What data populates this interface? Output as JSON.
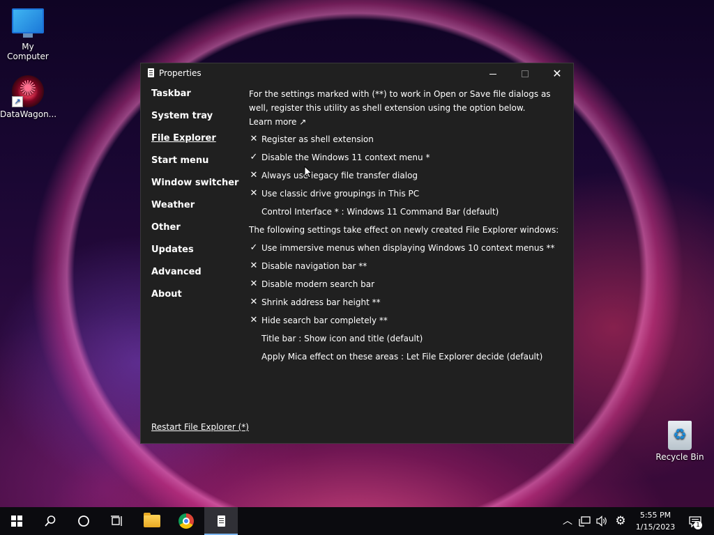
{
  "desktop": {
    "icons": [
      {
        "label": "My Computer",
        "icon": "computer-icon"
      },
      {
        "label": "DataWagon...",
        "icon": "datawagon-icon"
      },
      {
        "label": "Recycle Bin",
        "icon": "recycle-bin-icon"
      }
    ]
  },
  "window": {
    "title": "Properties",
    "controls": {
      "minimize": "minimize-icon",
      "maximize": "maximize-icon",
      "close": "✕"
    }
  },
  "sidebar": {
    "items": [
      {
        "label": "Taskbar",
        "active": false
      },
      {
        "label": "System tray",
        "active": false
      },
      {
        "label": "File Explorer",
        "active": true
      },
      {
        "label": "Start menu",
        "active": false
      },
      {
        "label": "Window switcher",
        "active": false
      },
      {
        "label": "Weather",
        "active": false
      },
      {
        "label": "Other",
        "active": false
      },
      {
        "label": "Updates",
        "active": false
      },
      {
        "label": "Advanced",
        "active": false
      },
      {
        "label": "About",
        "active": false
      }
    ],
    "restart_link": "Restart File Explorer (*)"
  },
  "content": {
    "intro": "For the settings marked with (**) to work in Open or Save file dialogs as well, register this utility as shell extension using the option below.",
    "learn_more": "Learn more ↗",
    "options_group1": [
      {
        "mark": "✕",
        "label": "Register as shell extension"
      },
      {
        "mark": "✓",
        "label": "Disable the Windows 11 context menu *"
      },
      {
        "mark": "✕",
        "label": "Always use legacy file transfer dialog"
      },
      {
        "mark": "✕",
        "label": "Use classic drive groupings in This PC"
      }
    ],
    "control_interface": "Control Interface * : Windows 11 Command Bar (default)",
    "section_text": "The following settings take effect on newly created File Explorer windows:",
    "options_group2": [
      {
        "mark": "✓",
        "label": "Use immersive menus when displaying Windows 10 context menus **"
      },
      {
        "mark": "✕",
        "label": "Disable navigation bar **"
      },
      {
        "mark": "✕",
        "label": "Disable modern search bar"
      },
      {
        "mark": "✕",
        "label": "Shrink address bar height **"
      },
      {
        "mark": "✕",
        "label": "Hide search bar completely **"
      }
    ],
    "title_bar": "Title bar : Show icon and title (default)",
    "mica": "Apply Mica effect on these areas : Let File Explorer decide (default)"
  },
  "taskbar": {
    "clock_time": "5:55 PM",
    "clock_date": "1/15/2023",
    "notification_count": "1",
    "accent": "#7db6f0"
  }
}
